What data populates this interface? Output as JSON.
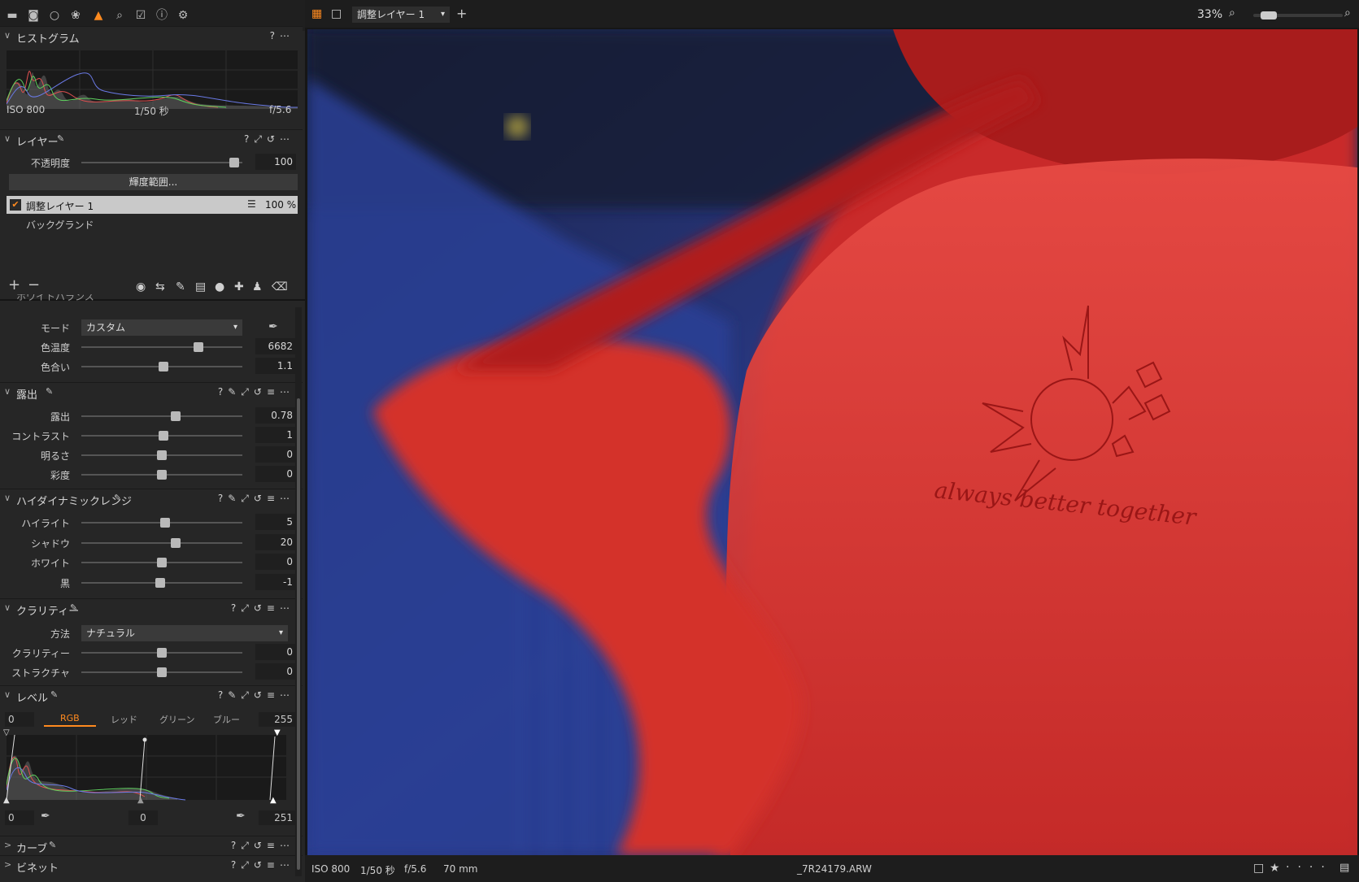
{
  "toolbar": {
    "icons": [
      "folder-icon",
      "camera-icon",
      "circle-icon",
      "color-icon",
      "adjust-icon",
      "search-icon",
      "checklist-icon",
      "info-icon",
      "gear-icon"
    ]
  },
  "histogram": {
    "title": "ヒストグラム",
    "iso": "ISO 800",
    "shutter": "1/50 秒",
    "aperture": "f/5.6",
    "help": "?",
    "more": "⋯"
  },
  "layers": {
    "title": "レイヤー",
    "opacity_label": "不透明度",
    "opacity_value": "100",
    "opacity": 0.98,
    "luma_button": "輝度範囲...",
    "items": [
      {
        "name": "調整レイヤー 1",
        "percent": "100 %",
        "selected": true
      },
      {
        "name": "バックグランド",
        "selected": false
      }
    ],
    "add": "+",
    "remove": "−"
  },
  "white_balance": {
    "title": "ホワイトバランス",
    "mode_label": "モード",
    "mode_value": "カスタム",
    "kelvin_label": "色温度",
    "kelvin_value": "6682",
    "kelvin": 0.74,
    "tint_label": "色合い",
    "tint_value": "1.1",
    "tint": 0.51
  },
  "exposure": {
    "title": "露出",
    "rows": [
      {
        "label": "露出",
        "value": "0.78",
        "pos": 0.59
      },
      {
        "label": "コントラスト",
        "value": "1",
        "pos": 0.51
      },
      {
        "label": "明るさ",
        "value": "0",
        "pos": 0.5
      },
      {
        "label": "彩度",
        "value": "0",
        "pos": 0.5
      }
    ]
  },
  "hdr": {
    "title": "ハイダイナミックレンジ",
    "rows": [
      {
        "label": "ハイライト",
        "value": "5",
        "pos": 0.52
      },
      {
        "label": "シャドウ",
        "value": "20",
        "pos": 0.59
      },
      {
        "label": "ホワイト",
        "value": "0",
        "pos": 0.5
      },
      {
        "label": "黒",
        "value": "-1",
        "pos": 0.49
      }
    ]
  },
  "clarity": {
    "title": "クラリティー",
    "method_label": "方法",
    "method_value": "ナチュラル",
    "rows": [
      {
        "label": "クラリティー",
        "value": "0",
        "pos": 0.5
      },
      {
        "label": "ストラクチャ",
        "value": "0",
        "pos": 0.5
      }
    ]
  },
  "levels": {
    "title": "レベル",
    "left_value": "0",
    "right_value": "255",
    "channels": [
      "RGB",
      "レッド",
      "グリーン",
      "ブルー"
    ],
    "active_channel": "RGB",
    "out_left": "0",
    "out_mid": "0",
    "out_right": "251"
  },
  "curve": {
    "title": "カーブ"
  },
  "vignette": {
    "title": "ビネット"
  },
  "viewer": {
    "tab_label": "調整レイヤー 1",
    "zoom": "33%",
    "zoom_fraction": 0.1,
    "shirt_text": "always better together"
  },
  "statusbar": {
    "iso": "ISO 800",
    "shutter": "1/50 秒",
    "aperture": "f/5.6",
    "focal": "70 mm",
    "filename": "_7R24179.ARW"
  },
  "colors": {
    "accent": "#ff8a1f",
    "panel": "#262626",
    "photo_red": "#d8302c"
  }
}
